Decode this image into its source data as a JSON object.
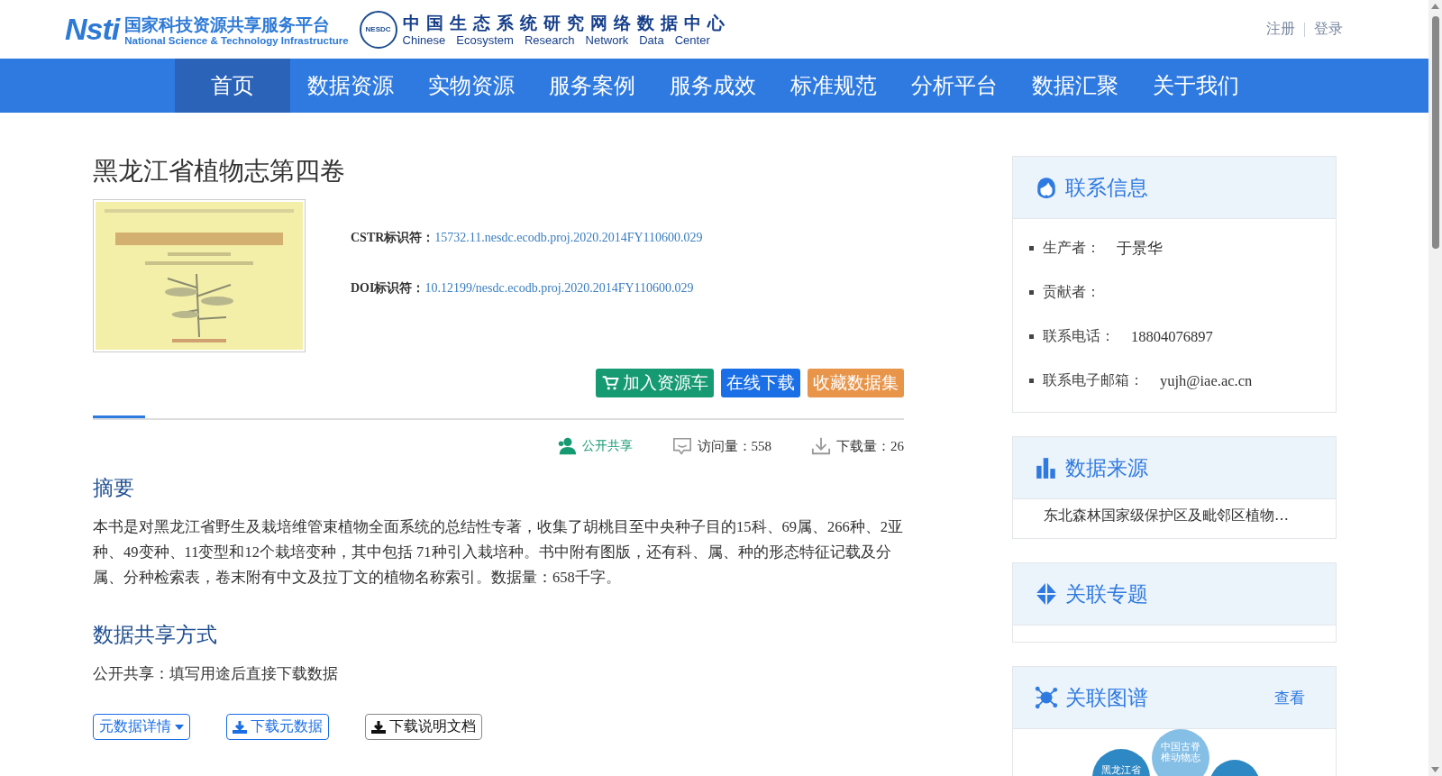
{
  "header": {
    "logo_nsti": {
      "mark": "Nsti",
      "title": "国家科技资源共享服务平台",
      "subtitle": "National Science & Technology Infrastructure"
    },
    "logo_nesdc": {
      "mark": "NESDC",
      "title": "中国生态系统研究网络数据中心",
      "subtitle": [
        "Chinese",
        "Ecosystem",
        "Research",
        "Network",
        "Data",
        "Center"
      ]
    },
    "links": [
      "注册",
      "登录"
    ]
  },
  "nav": [
    {
      "label": "首页",
      "selected": true
    },
    {
      "label": "数据资源",
      "selected": false
    },
    {
      "label": "实物资源",
      "selected": false
    },
    {
      "label": "服务案例",
      "selected": false
    },
    {
      "label": "服务成效",
      "selected": false
    },
    {
      "label": "标准规范",
      "selected": false
    },
    {
      "label": "分析平台",
      "selected": false
    },
    {
      "label": "数据汇聚",
      "selected": false
    },
    {
      "label": "关于我们",
      "selected": false
    }
  ],
  "dataset": {
    "title": "黑龙江省植物志第四卷",
    "identifiers": [
      {
        "label": "CSTR标识符：",
        "value": "15732.11.nesdc.ecodb.proj.2020.2014FY110600.029"
      },
      {
        "label": "DOI标识符：",
        "value": "10.12199/nesdc.ecodb.proj.2020.2014FY110600.029"
      }
    ],
    "actions": [
      {
        "kind": "cart",
        "label": "加入资源车"
      },
      {
        "kind": "download",
        "label": "在线下载"
      },
      {
        "kind": "favorite",
        "label": "收藏数据集"
      }
    ],
    "stats": [
      {
        "kind": "share",
        "text": "公开共享"
      },
      {
        "kind": "visits",
        "text": "访问量：558"
      },
      {
        "kind": "downloads",
        "text": "下载量：26"
      }
    ],
    "sections": [
      {
        "heading": "摘要",
        "text": "本书是对黑龙江省野生及栽培维管束植物全面系统的总结性专著，收集了胡桃目至中央种子目的15科、69属、266种、2亚种、49变种、11变型和12个栽培变种，其中包括 71种引入栽培种。书中附有图版，还有科、属、种的形态特征记载及分属、分种检索表，卷末附有中文及拉丁文的植物名称索引。数据量：658千字。"
      },
      {
        "heading": "数据共享方式",
        "text": "公开共享：填写用途后直接下载数据"
      }
    ],
    "bottom_buttons": [
      {
        "kind": "dropdown",
        "label": "元数据详情"
      },
      {
        "kind": "download",
        "label": "下载元数据"
      },
      {
        "kind": "document",
        "label": "下载说明文档"
      }
    ]
  },
  "sidebar": [
    {
      "kind": "contact",
      "title": "联系信息",
      "items": [
        {
          "label": "生产者：",
          "value": "于景华"
        },
        {
          "label": "贡献者："
        },
        {
          "label": "联系电话：",
          "value": "18804076897"
        },
        {
          "label": "联系电子邮箱：",
          "value": "yujh@iae.ac.cn"
        }
      ]
    },
    {
      "kind": "source",
      "title": "数据来源",
      "text": "东北森林国家级保护区及毗邻区植物…"
    },
    {
      "kind": "topic",
      "title": "关联专题"
    },
    {
      "kind": "graph",
      "title": "关联图谱",
      "link": "查看",
      "nodes": [
        {
          "text": "黑龙江省",
          "color": "#2e88c4"
        },
        {
          "text": "中国古脊椎动物志",
          "color": "#86bfe6"
        },
        {
          "color": "#2e88c4"
        }
      ]
    }
  ]
}
